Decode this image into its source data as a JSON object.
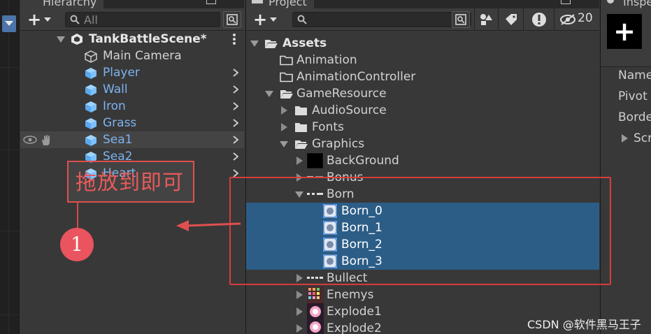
{
  "hierarchy": {
    "tab_label": "Hierarchy",
    "search_placeholder": "All",
    "scene_name": "TankBattleScene*",
    "items": [
      {
        "label": "Main Camera",
        "color": "#d2d2d2",
        "icon": "camera-gameobject-icon"
      },
      {
        "label": "Player",
        "color": "#7cb3f0",
        "icon": "prefab-cube-icon"
      },
      {
        "label": "Wall",
        "color": "#7cb3f0",
        "icon": "prefab-cube-icon"
      },
      {
        "label": "Iron",
        "color": "#7cb3f0",
        "icon": "prefab-cube-icon"
      },
      {
        "label": "Grass",
        "color": "#7cb3f0",
        "icon": "prefab-cube-icon"
      },
      {
        "label": "Sea1",
        "color": "#7cb3f0",
        "icon": "prefab-cube-icon"
      },
      {
        "label": "Sea2",
        "color": "#7cb3f0",
        "icon": "prefab-cube-icon"
      },
      {
        "label": "Heart",
        "color": "#7cb3f0",
        "icon": "prefab-cube-icon"
      }
    ]
  },
  "project": {
    "tab_label": "Project",
    "hidden_count": "20",
    "tree": [
      {
        "label": "Assets",
        "bold": true
      },
      {
        "label": "Animation"
      },
      {
        "label": "AnimationController"
      },
      {
        "label": "GameResource"
      },
      {
        "label": "AudioSource"
      },
      {
        "label": "Fonts"
      },
      {
        "label": "Graphics"
      },
      {
        "label": "BackGround"
      },
      {
        "label": "Bonus"
      },
      {
        "label": "Born"
      },
      {
        "label": "Born_0"
      },
      {
        "label": "Born_1"
      },
      {
        "label": "Born_2"
      },
      {
        "label": "Born_3"
      },
      {
        "label": "Bullect"
      },
      {
        "label": "Enemys"
      },
      {
        "label": "Explode1"
      },
      {
        "label": "Explode2"
      }
    ]
  },
  "inspector": {
    "tab_label": "Inspector",
    "fields": [
      "Name",
      "Pivot",
      "Border",
      "Scr"
    ]
  },
  "annotation": {
    "text": "拖放到即可",
    "step_number": "1"
  },
  "watermark": "CSDN @软件黑马王子",
  "colors": {
    "selection": "#2c5d87",
    "prefab_blue": "#7cb3f0",
    "annotation_red": "#e04f4f"
  }
}
